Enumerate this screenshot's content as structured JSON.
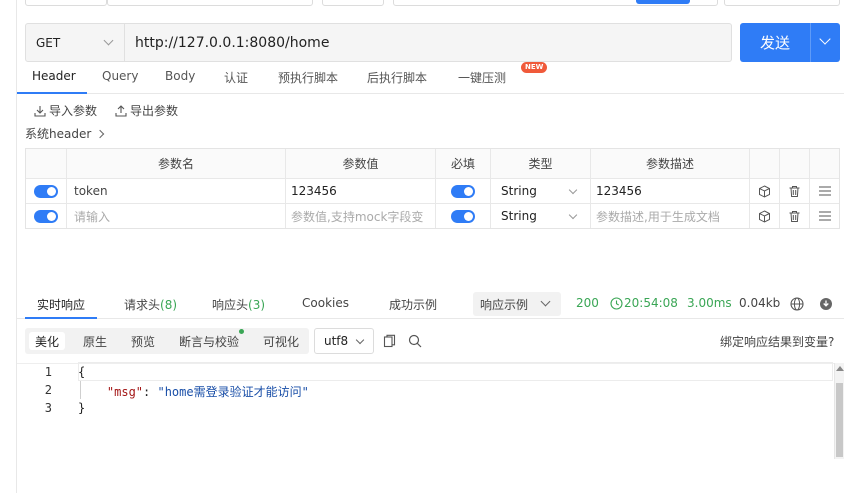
{
  "request": {
    "method": "GET",
    "url": "http://127.0.0.1:8080/home",
    "send_label": "发送"
  },
  "request_tabs": [
    {
      "label": "Header",
      "active": true
    },
    {
      "label": "Query"
    },
    {
      "label": "Body"
    },
    {
      "label": "认证"
    },
    {
      "label": "预执行脚本"
    },
    {
      "label": "后执行脚本"
    },
    {
      "label": "一键压测"
    }
  ],
  "new_badge": "NEW",
  "tools": {
    "import_label": "导入参数",
    "export_label": "导出参数",
    "system_header": "系统header"
  },
  "params_table": {
    "headers": [
      "参数名",
      "参数值",
      "必填",
      "类型",
      "参数描述"
    ],
    "rows": [
      {
        "name": "token",
        "value": "123456",
        "type": "String",
        "description": "123456",
        "enabled": true,
        "required": true
      },
      {
        "name": "请输入",
        "value": "参数值,支持mock字段变",
        "type": "String",
        "description": "参数描述,用于生成文档",
        "enabled": true,
        "required": true,
        "placeholder": true
      }
    ]
  },
  "response_tabs": [
    {
      "label": "实时响应",
      "active": true
    },
    {
      "label": "请求头",
      "count": "(8)"
    },
    {
      "label": "响应头",
      "count": "(3)"
    },
    {
      "label": "Cookies"
    },
    {
      "label": "成功示例"
    }
  ],
  "response_example_label": "响应示例",
  "status": {
    "code": "200",
    "time": "20:54:08",
    "duration": "3.00ms",
    "size": "0.04kb"
  },
  "view_tabs": [
    {
      "label": "美化",
      "active": true
    },
    {
      "label": "原生"
    },
    {
      "label": "预览"
    },
    {
      "label": "断言与校验"
    },
    {
      "label": "可视化"
    }
  ],
  "encoding": "utf8",
  "bind_var_label": "绑定响应结果到变量?",
  "code": {
    "line_numbers": [
      "1",
      "2",
      "3"
    ],
    "line1": "{",
    "key": "\"msg\"",
    "colon": ": ",
    "value": "\"home需登录验证才能访问\"",
    "line3": "}"
  },
  "colors": {
    "primary": "#2f7cf6",
    "success": "#3aa655",
    "badge": "#f05a3a"
  }
}
